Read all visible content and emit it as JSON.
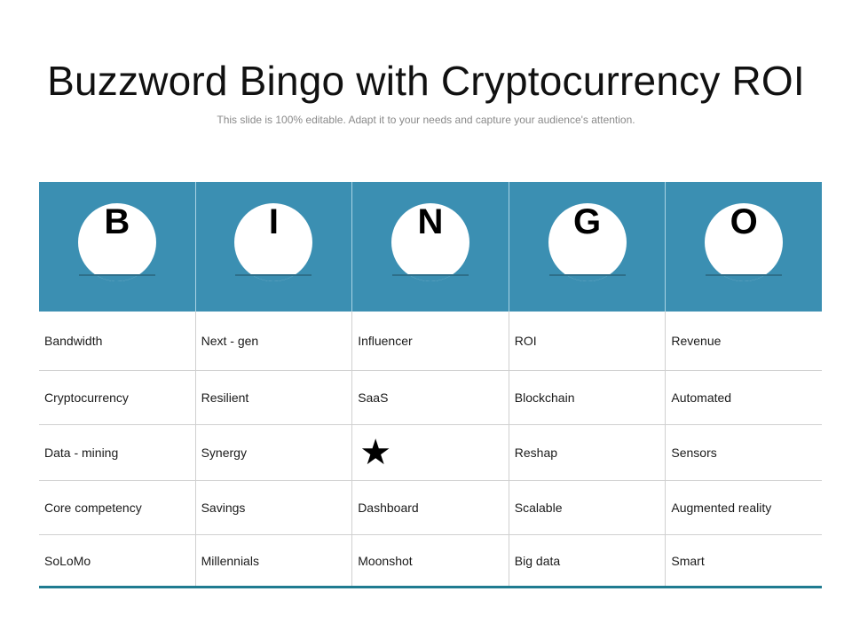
{
  "slide": {
    "title": "Buzzword Bingo with Cryptocurrency ROI",
    "subtitle": "This slide is 100% editable. Adapt it to your needs and capture your audience's attention."
  },
  "colors": {
    "header_bg": "#3b8fb2",
    "bottom_rule": "#1f7b90",
    "grid_line": "#d0d0d0"
  },
  "bingo": {
    "letters": [
      "B",
      "I",
      "N",
      "G",
      "O"
    ],
    "rows": [
      [
        "Bandwidth",
        "Next - gen",
        "Influencer",
        "ROI",
        "Revenue"
      ],
      [
        "Cryptocurrency",
        "Resilient",
        "SaaS",
        "Blockchain",
        "Automated"
      ],
      [
        "Data - mining",
        "Synergy",
        "star-icon",
        "Reshap",
        "Sensors"
      ],
      [
        "Core competency",
        "Savings",
        "Dashboard",
        "Scalable",
        "Augmented reality"
      ],
      [
        "SoLoMo",
        "Millennials",
        "Moonshot",
        "Big data",
        "Smart"
      ]
    ],
    "free_space": {
      "row": 2,
      "col": 2,
      "icon": "star-icon",
      "glyph": "★"
    }
  }
}
